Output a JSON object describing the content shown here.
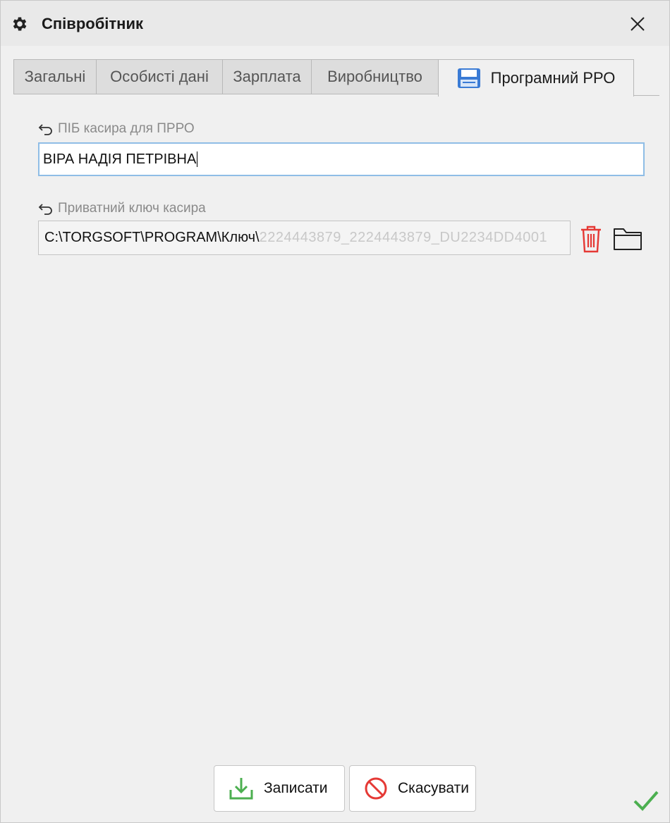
{
  "window": {
    "title": "Співробітник",
    "title_icon": "gear-icon",
    "close_icon": "close-icon"
  },
  "tabs": [
    {
      "label": "Загальні",
      "active": false
    },
    {
      "label": "Особисті дані",
      "active": false
    },
    {
      "label": "Зарплата",
      "active": false
    },
    {
      "label": "Виробництво",
      "active": false
    },
    {
      "label": "Програмний РРО",
      "active": true,
      "icon": "floppy-disk-icon"
    }
  ],
  "form": {
    "pib_label": "ПІБ касира для ПРРО",
    "pib_value": "ВІРА НАДІЯ ПЕТРІВНА",
    "key_label": "Приватний ключ касира",
    "key_value": "C:\\TORGSOFT\\PROGRAM\\Ключ\\",
    "key_value_obscured": "2224443879_2224443879_DU2234DD4001"
  },
  "buttons": {
    "save_label": "Записати",
    "cancel_label": "Скасувати"
  },
  "colors": {
    "accent_green": "#4caf50",
    "delete_red": "#e53935",
    "focus_border": "#8fbde6"
  }
}
